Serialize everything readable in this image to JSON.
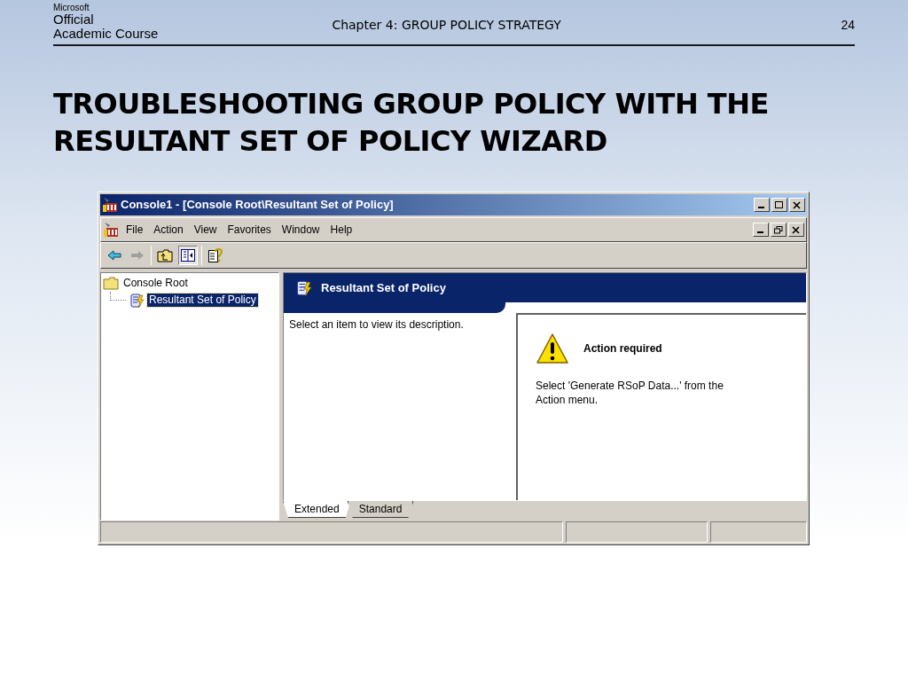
{
  "slide": {
    "logo": {
      "brand": "Microsoft",
      "line_1": "Official",
      "line_2": "Academic Course"
    },
    "chapter": "Chapter 4: GROUP POLICY STRATEGY",
    "page_number": "24",
    "title_lines": [
      "TROUBLESHOOTING GROUP POLICY WITH THE",
      "RESULTANT SET OF POLICY WIZARD"
    ]
  },
  "window": {
    "title": "Console1 - [Console Root\\Resultant Set of Policy]",
    "menu": [
      "File",
      "Action",
      "View",
      "Favorites",
      "Window",
      "Help"
    ],
    "tree": [
      {
        "label": "Console Root",
        "selected": false,
        "children": [
          {
            "label": "Resultant Set of Policy",
            "selected": true
          }
        ]
      }
    ],
    "pane_header": "Resultant Set of Policy",
    "description": "Select an item to view its description.",
    "notice": {
      "title": "Action required",
      "text": "Select 'Generate RSoP Data...' from the Action menu."
    },
    "tabs": [
      {
        "label": "Extended",
        "selected": true
      },
      {
        "label": "Standard",
        "selected": false
      }
    ]
  }
}
